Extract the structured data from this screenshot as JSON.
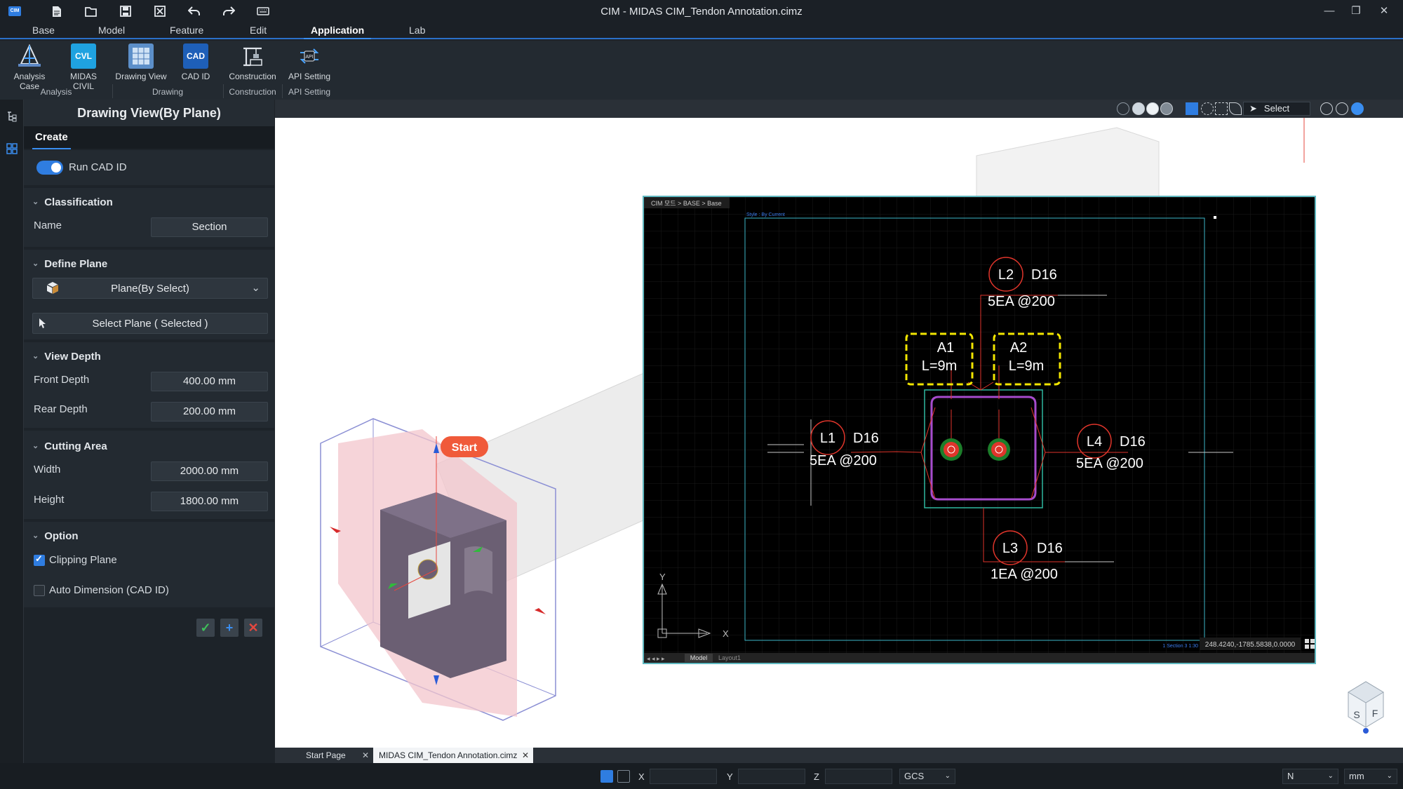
{
  "app": {
    "title": "CIM - MIDAS CIM_Tendon Annotation.cimz",
    "logo_text": "CIM"
  },
  "quick_access": [
    {
      "icon": "new-file-icon"
    },
    {
      "icon": "open-folder-icon"
    },
    {
      "icon": "save-icon"
    },
    {
      "icon": "close-file-icon"
    },
    {
      "icon": "undo-icon"
    },
    {
      "icon": "redo-icon"
    },
    {
      "icon": "keyboard-icon"
    }
  ],
  "menu_tabs": [
    {
      "label": "Base"
    },
    {
      "label": "Model"
    },
    {
      "label": "Feature"
    },
    {
      "label": "Edit"
    },
    {
      "label": "Application",
      "active": true
    },
    {
      "label": "Lab"
    }
  ],
  "ribbon": {
    "buttons": [
      {
        "label": "Analysis Case",
        "icon": "analysis-case-icon"
      },
      {
        "label": "MIDAS CIVIL",
        "icon": "midas-civil-icon",
        "badge": "CVL"
      },
      {
        "label": "Drawing View",
        "icon": "drawing-view-icon"
      },
      {
        "label": "CAD ID",
        "icon": "cad-id-icon",
        "badge": "CAD"
      },
      {
        "label": "Construction",
        "icon": "construction-icon"
      },
      {
        "label": "API Setting",
        "icon": "api-setting-icon",
        "badge": "API"
      }
    ],
    "groups": [
      "Analysis",
      "Drawing",
      "Construction",
      "API Setting"
    ]
  },
  "panel": {
    "title": "Drawing View(By Plane)",
    "tab": "Create",
    "run_cad_id": {
      "label": "Run CAD ID",
      "on": true
    },
    "classification": {
      "header": "Classification",
      "name_label": "Name",
      "name_value": "Section"
    },
    "define_plane": {
      "header": "Define Plane",
      "plane_select": "Plane(By Select)",
      "select_plane_button": "Select Plane ( Selected )"
    },
    "view_depth": {
      "header": "View Depth",
      "front_label": "Front Depth",
      "front_value": "400.00 mm",
      "rear_label": "Rear Depth",
      "rear_value": "200.00 mm"
    },
    "cutting_area": {
      "header": "Cutting Area",
      "width_label": "Width",
      "width_value": "2000.00 mm",
      "height_label": "Height",
      "height_value": "1800.00 mm"
    },
    "option": {
      "header": "Option",
      "clipping_label": "Clipping Plane",
      "clipping_checked": true,
      "autodim_label": "Auto Dimension (CAD ID)",
      "autodim_checked": false
    },
    "actions": [
      {
        "icon": "check-icon",
        "color": "#3fbf5a"
      },
      {
        "icon": "plus-icon",
        "color": "#3a8ef0"
      },
      {
        "icon": "close-icon",
        "color": "#e5483f"
      }
    ]
  },
  "viewport": {
    "toolbar_select": "Select",
    "start_label": "Start",
    "view_cube": {
      "left": "S",
      "right": "F"
    }
  },
  "cad_view": {
    "breadcrumb": "CIM 모드 > BASE > Base",
    "style_text": "Style : By Current",
    "scale_text": "1 Section 3 1:30",
    "coords": "248.4240,-1785.5838,0.0000",
    "bottom_tabs": [
      "Model",
      "Layout1"
    ],
    "axis_x": "X",
    "axis_y": "Y",
    "labels": {
      "L1": {
        "id": "L1",
        "bar": "D16",
        "spec": "5EA @200"
      },
      "L2": {
        "id": "L2",
        "bar": "D16",
        "spec": "5EA @200"
      },
      "L3": {
        "id": "L3",
        "bar": "D16",
        "spec": "1EA @200"
      },
      "L4": {
        "id": "L4",
        "bar": "D16",
        "spec": "5EA @200"
      },
      "A1": {
        "id": "A1",
        "len": "L=9m"
      },
      "A2": {
        "id": "A2",
        "len": "L=9m"
      }
    }
  },
  "doc_tabs": [
    {
      "label": "Start Page"
    },
    {
      "label": "MIDAS CIM_Tendon Annotation.cimz",
      "active": true
    }
  ],
  "statusbar": {
    "x_label": "X",
    "y_label": "Y",
    "z_label": "Z",
    "coord_system": "GCS",
    "force_unit": "N",
    "length_unit": "mm"
  }
}
